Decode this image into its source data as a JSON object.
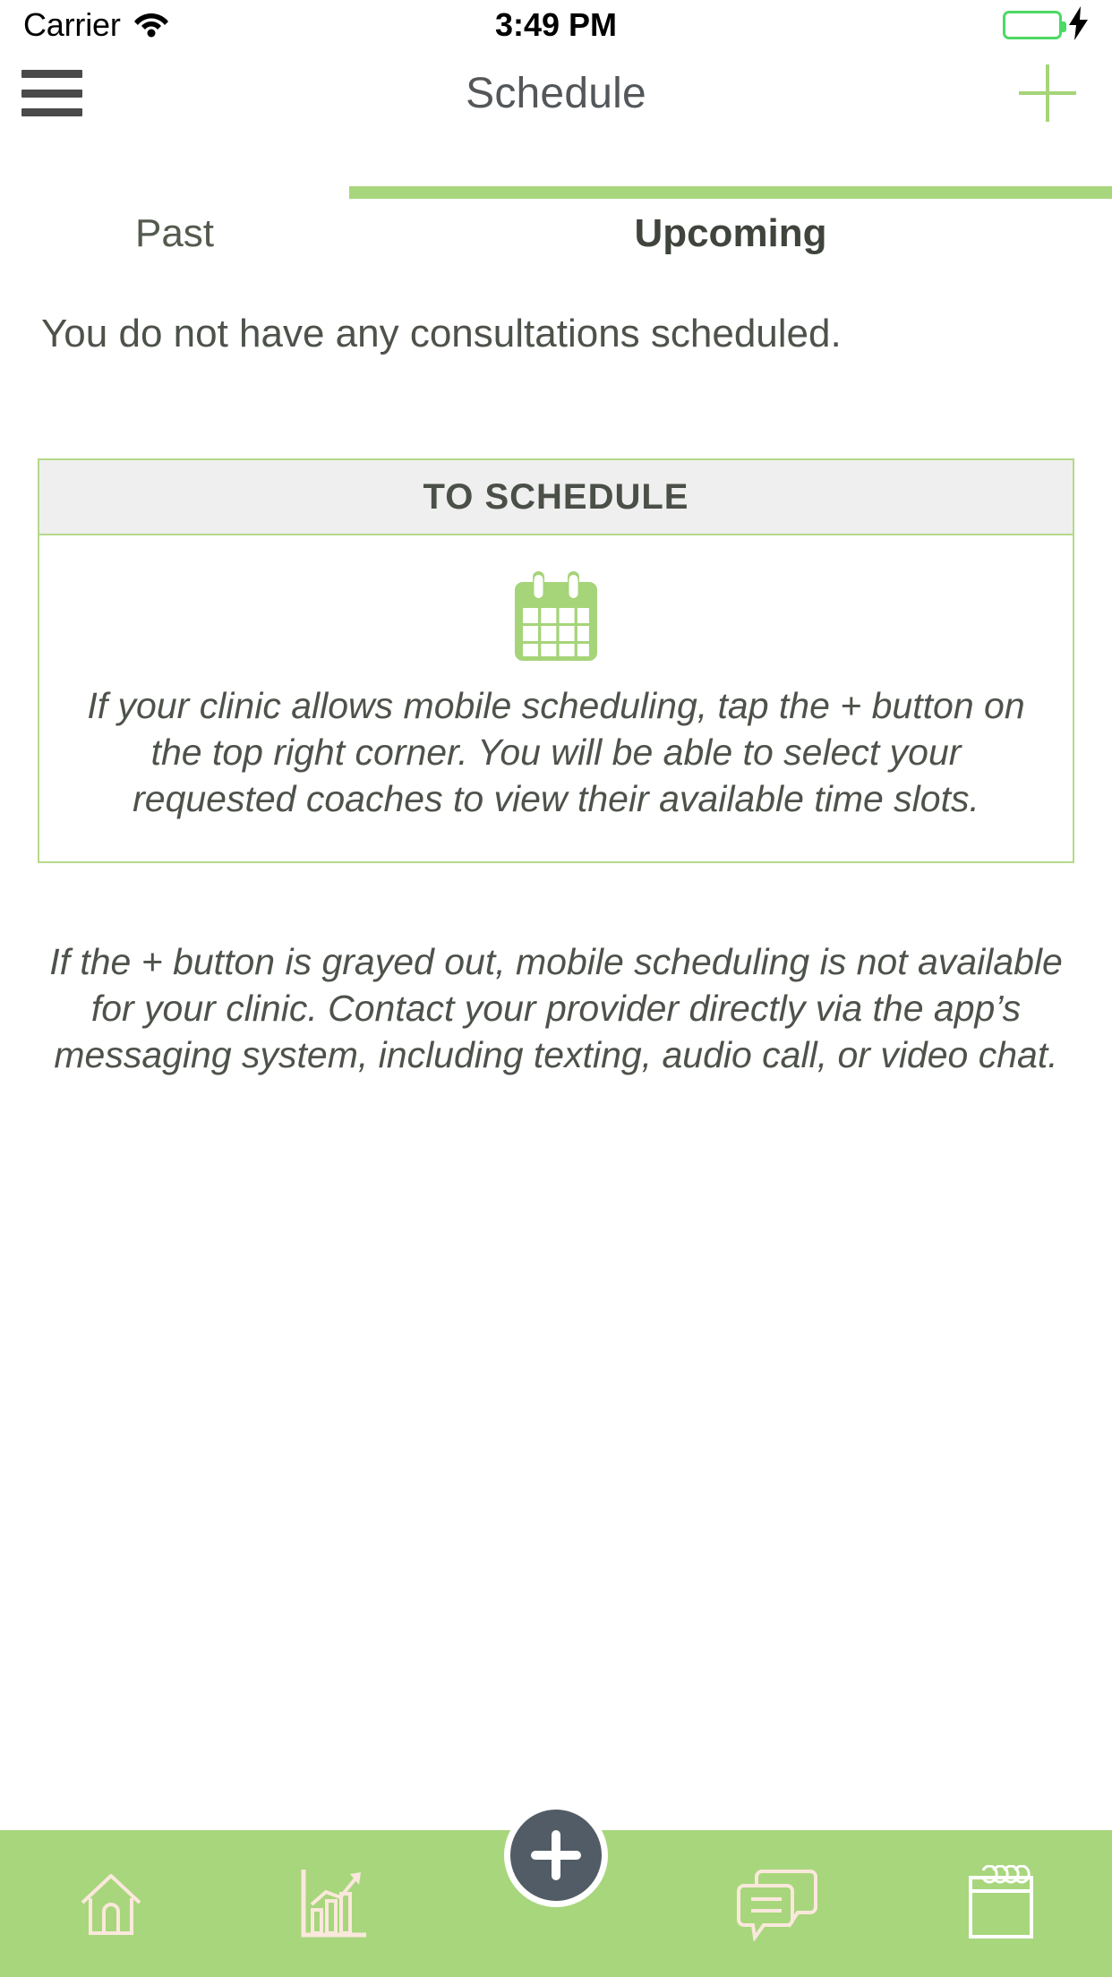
{
  "status_bar": {
    "carrier": "Carrier",
    "time": "3:49 PM",
    "wifi_icon": "wifi-icon",
    "battery_icon": "battery-icon",
    "charging_icon": "lightning-bolt-icon"
  },
  "nav": {
    "menu_icon": "hamburger-menu-icon",
    "title": "Schedule",
    "add_icon": "plus-icon"
  },
  "tabs": {
    "items": [
      {
        "label": "Past",
        "active": false
      },
      {
        "label": "Upcoming",
        "active": true
      }
    ]
  },
  "content": {
    "empty_message": "You do not have any consultations scheduled.",
    "card": {
      "header": "TO SCHEDULE",
      "icon": "calendar-icon",
      "body": "If your clinic allows mobile scheduling, tap the + button on the top right corner. You will be able to select your requested coaches to view their available time slots."
    },
    "note": "If the + button is grayed out, mobile scheduling is not available for your clinic. Contact your provider directly via the app’s messaging system, including texting, audio call, or video chat."
  },
  "bottom_bar": {
    "items": [
      {
        "icon": "home-icon"
      },
      {
        "icon": "chart-icon"
      },
      {
        "icon": "chat-bubbles-icon"
      },
      {
        "icon": "calendar-notepad-icon"
      }
    ],
    "fab_icon": "plus-icon"
  },
  "colors": {
    "accent_green": "#a8d67d",
    "card_border_green": "#b5d98a",
    "icon_green": "#a5d479",
    "battery_green": "#4cd964",
    "text_dark": "#4d524a",
    "fab_dark": "#515c66"
  }
}
